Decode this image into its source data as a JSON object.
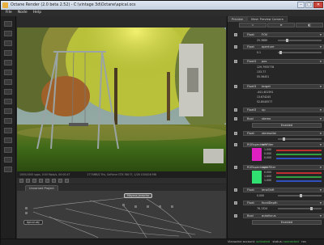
{
  "window": {
    "title": "Octane Render (2.0 beta 2.52) - C:\\vintage 3d\\Octane\\apical.ocs",
    "buttons": [
      "–",
      "□",
      "✕"
    ]
  },
  "menu": [
    "File",
    "Node",
    "Help"
  ],
  "render_status": {
    "left": "1000/1000 spps, 0:00 Mpix/s, 00:00:47",
    "right": "2774MB/2 Tris, GeForce GTX 560 Ti, 1/26 1000/16 MB"
  },
  "node_editor": {
    "project_tab": "Unnamed Project",
    "nodes": [
      "Mbyana_brascha",
      "Apical.obj"
    ]
  },
  "panel": {
    "tabs": [
      "Preview",
      "Mesh Preview Camera"
    ],
    "top_buttons": [
      "=",
      "≡",
      "◧"
    ],
    "params": [
      {
        "type": "Float",
        "name": "FOV",
        "value": "25.3689"
      },
      {
        "type": "Float",
        "name": "aperture",
        "value": "0.1"
      },
      {
        "type": "Float3",
        "name": "pos",
        "values": [
          "129.7935778",
          "133.77",
          "55.56451"
        ]
      },
      {
        "type": "Float3",
        "name": "target",
        "values": [
          "-441.401591",
          "13.674245",
          "52.8545577"
        ]
      },
      {
        "type": "Float3",
        "name": "up"
      },
      {
        "type": "Bool",
        "name": "stereo",
        "value": "Enabled"
      },
      {
        "type": "Float",
        "name": "stereodist"
      },
      {
        "type": "RGBspectrum",
        "name": "leftFilter",
        "values": [
          "1.000",
          "0.000",
          "0.000"
        ],
        "color": "#e020c0"
      },
      {
        "type": "RGBspectrum",
        "name": "rightFilter",
        "values": [
          "0.000",
          "1.000",
          "1.000"
        ],
        "color": "#30e070"
      },
      {
        "type": "Float",
        "name": "lensShift",
        "value": "0.000"
      },
      {
        "type": "Float",
        "name": "focalDepth",
        "value": "76.1324"
      },
      {
        "type": "Bool",
        "name": "autofocus",
        "value": "Enabled"
      }
    ]
  },
  "statusbar": {
    "account": "Vianozine account:",
    "account_state": "activated",
    "status_label": "status:",
    "status_value": "connected",
    "scroll": "res"
  }
}
